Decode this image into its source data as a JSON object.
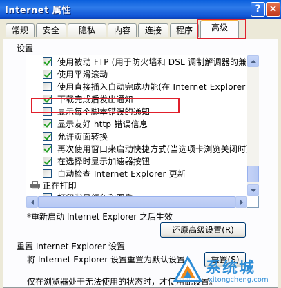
{
  "window": {
    "title": "Internet 属性",
    "help_label": "?",
    "close_label": "×"
  },
  "tabs": [
    {
      "label": "常规"
    },
    {
      "label": "安全"
    },
    {
      "label": "隐私"
    },
    {
      "label": "内容"
    },
    {
      "label": "连接"
    },
    {
      "label": "程序"
    },
    {
      "label": "高级",
      "active": true
    }
  ],
  "settings": {
    "group_label": "设置",
    "items": [
      {
        "text": "使用被动 FTP (用于防火墙和 DSL 调制解调器的兼容",
        "checked": true
      },
      {
        "text": "使用平滑滚动",
        "checked": true
      },
      {
        "text": "使用直接插入自动完成功能(在 Internet Explorer 1",
        "checked": false
      },
      {
        "text": "下载完成后发出通知",
        "checked": true
      },
      {
        "text": "显示每个脚本错误的通知",
        "checked": false
      },
      {
        "text": "显示友好 http 错误信息",
        "checked": true
      },
      {
        "text": "允许页面转换",
        "checked": true
      },
      {
        "text": "再次使用窗口来启动快捷方式(当选项卡浏览关闭时)",
        "checked": true
      },
      {
        "text": "在选择时显示加速器按钮",
        "checked": true
      },
      {
        "text": "自动检查 Internet Explorer 更新",
        "checked": false
      }
    ],
    "printing_header": "正在打印",
    "printing_item": {
      "text": "打印背景颜色和图像",
      "checked": false
    }
  },
  "restart_note": "*重新启动 Internet Explorer 之后生效",
  "restore_button": "还原高级设置(R)",
  "reset": {
    "title": "重置 Internet Explorer 设置",
    "description": "将 Internet Explorer 设置重置为默认设置",
    "button": "重置(S)",
    "info": "仅在浏览器处于无法使用的状态时，才使用此设置。"
  },
  "watermark": {
    "brand": "系统城",
    "url": "xitongcheng.com"
  },
  "colors": {
    "highlight": "#E0202C",
    "titlebar": "#0A5FDC",
    "check": "#21A121"
  }
}
